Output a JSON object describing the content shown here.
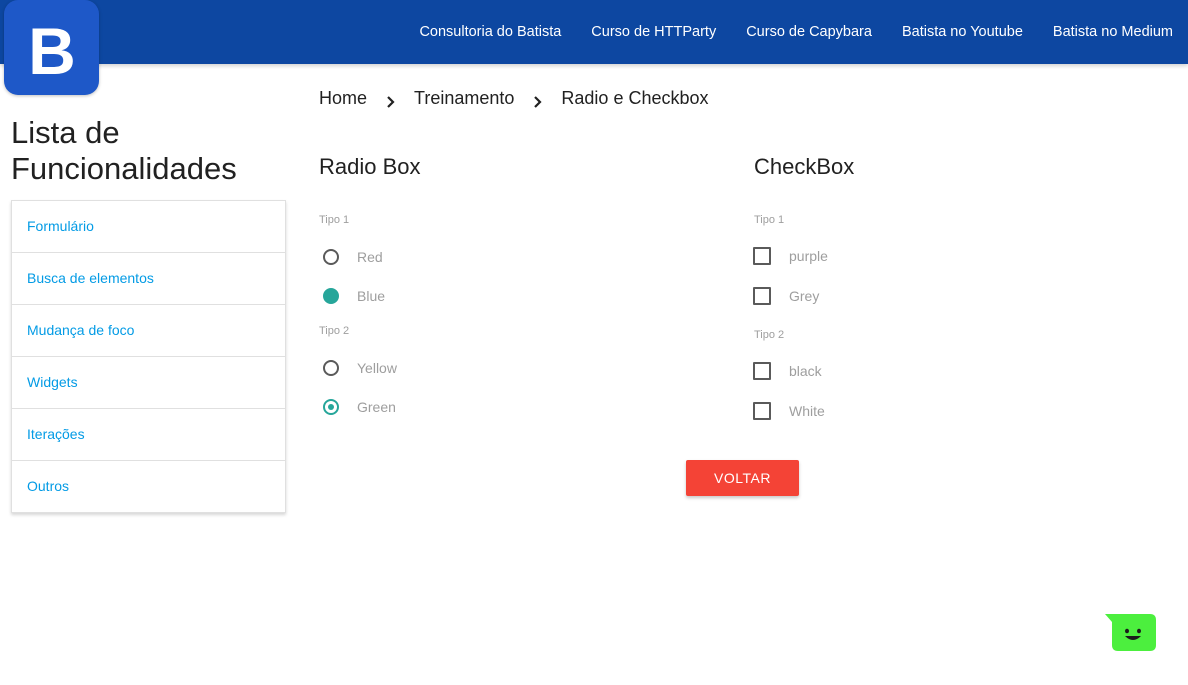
{
  "brand": {
    "logo_letter": "B",
    "logo_color": "#1e58c8"
  },
  "nav": {
    "links": [
      "Consultoria do Batista",
      "Curso de HTTParty",
      "Curso de Capybara",
      "Batista no Youtube",
      "Batista no Medium"
    ]
  },
  "sidebar": {
    "title": "Lista de Funcionalidades",
    "items": [
      "Formulário",
      "Busca de elementos",
      "Mudança de foco",
      "Widgets",
      "Iterações",
      "Outros"
    ]
  },
  "breadcrumb": [
    "Home",
    "Treinamento",
    "Radio e Checkbox"
  ],
  "radio_section": {
    "title": "Radio Box",
    "groups": [
      {
        "label": "Tipo 1",
        "options": [
          {
            "label": "Red",
            "state": "unchecked"
          },
          {
            "label": "Blue",
            "state": "checked-filled"
          }
        ]
      },
      {
        "label": "Tipo 2",
        "options": [
          {
            "label": "Yellow",
            "state": "unchecked"
          },
          {
            "label": "Green",
            "state": "checked"
          }
        ]
      }
    ]
  },
  "checkbox_section": {
    "title": "CheckBox",
    "groups": [
      {
        "label": "Tipo 1",
        "options": [
          {
            "label": "purple",
            "checked": false
          },
          {
            "label": "Grey",
            "checked": false
          }
        ]
      },
      {
        "label": "Tipo 2",
        "options": [
          {
            "label": "black",
            "checked": false
          },
          {
            "label": "White",
            "checked": false
          }
        ]
      }
    ]
  },
  "actions": {
    "back_label": "VOLTAR"
  },
  "colors": {
    "nav_bg": "#0d47a1",
    "link": "#039be5",
    "accent_teal": "#26a69a",
    "button_red": "#f44336",
    "chat_green": "#4cef3e"
  },
  "chat_widget": {
    "icon": "smiley-chat-icon"
  }
}
